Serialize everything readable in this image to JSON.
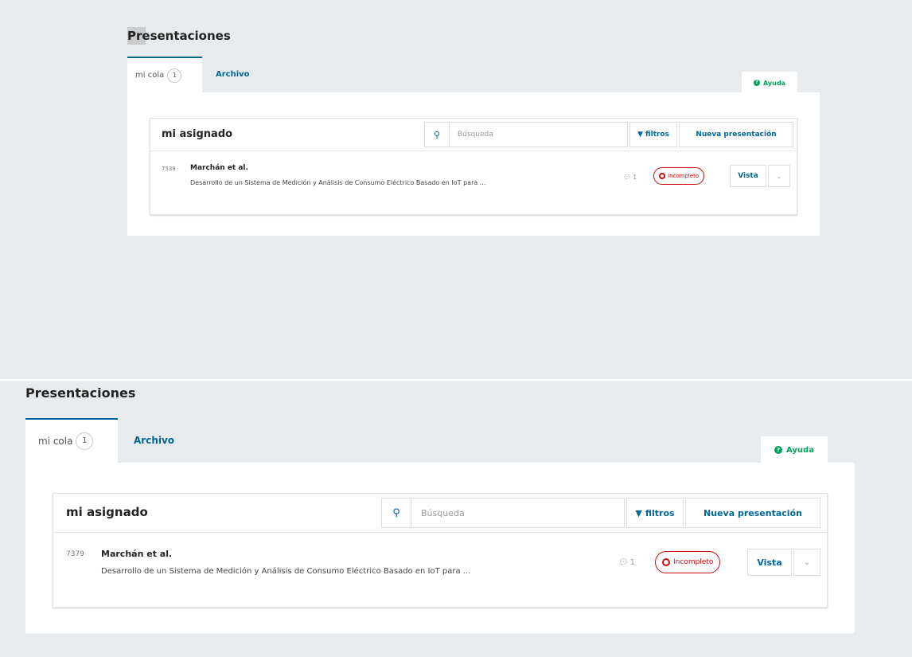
{
  "page": {
    "title": "Presentaciones",
    "tabs": [
      {
        "label": "mi cola",
        "count": "1"
      },
      {
        "label": "Archivo"
      }
    ],
    "help": {
      "label": "Ayuda",
      "icon": "question-circle-icon"
    }
  },
  "queue": {
    "title": "mi asignado",
    "search": {
      "placeholder": "Búsqueda",
      "icon": "search-icon"
    },
    "filters_label": "filtros",
    "filters_icon": "filter-icon",
    "new_label": "Nueva presentación"
  },
  "screens": [
    {
      "submission": {
        "id": "7538",
        "author": "Marchán et al.",
        "title": "Desarrollo de un Sistema de Medición y Análisis de Consumo Eléctrico Basado en IoT para ...",
        "comments": "1",
        "status": "Incompleto",
        "view_label": "Vista"
      }
    },
    {
      "submission": {
        "id": "7379",
        "author": "Marchán et al.",
        "title": "Desarrollo de un Sistema de Medición y Análisis de Consumo Eléctrico Basado en IoT para ...",
        "comments": "1",
        "status": "Incompleto",
        "view_label": "Vista"
      }
    }
  ],
  "colors": {
    "accent": "#006798",
    "help_green": "#00a35c",
    "status_red": "#d00a0a",
    "background": "#e8ebed"
  }
}
